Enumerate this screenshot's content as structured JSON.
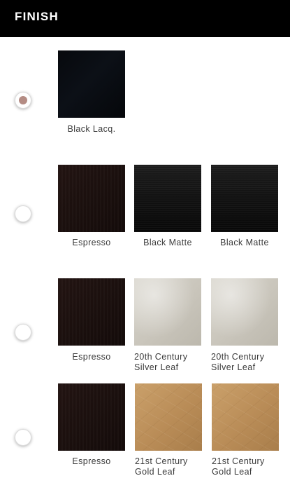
{
  "header": {
    "title": "FINISH"
  },
  "colors": {
    "header_bg": "#000000",
    "selected_dot": "#b48c84"
  },
  "options": [
    {
      "selected": true,
      "swatches": [
        {
          "label": "Black Lacq.",
          "finish": "black-lacquer"
        }
      ]
    },
    {
      "selected": false,
      "swatches": [
        {
          "label": "Espresso",
          "finish": "espresso"
        },
        {
          "label": "Black Matte",
          "finish": "black-matte"
        },
        {
          "label": "Black Matte",
          "finish": "black-matte"
        }
      ]
    },
    {
      "selected": false,
      "swatches": [
        {
          "label": "Espresso",
          "finish": "espresso"
        },
        {
          "label": "20th Century Silver Leaf",
          "finish": "silver-leaf"
        },
        {
          "label": "20th Century Silver Leaf",
          "finish": "silver-leaf"
        }
      ]
    },
    {
      "selected": false,
      "swatches": [
        {
          "label": "Espresso",
          "finish": "espresso"
        },
        {
          "label": "21st Century Gold Leaf",
          "finish": "gold-leaf"
        },
        {
          "label": "21st Century Gold Leaf",
          "finish": "gold-leaf"
        }
      ]
    }
  ]
}
